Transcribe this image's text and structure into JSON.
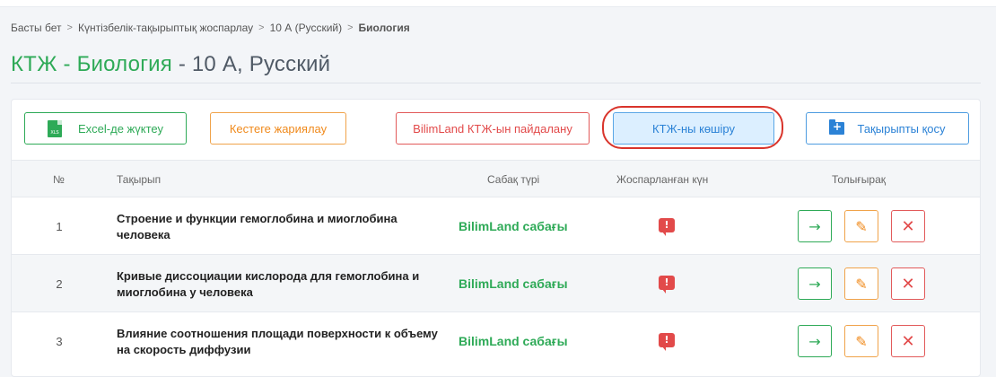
{
  "breadcrumb": {
    "items": [
      "Басты бет",
      "Күнтізбелік-тақырыптық жоспарлау",
      "10 А (Русский)"
    ],
    "current": "Биология",
    "separator": ">"
  },
  "title": {
    "highlight": "КТЖ - Биология",
    "rest": "- 10 А, Русский"
  },
  "toolbar": {
    "excel_label": "Excel-де жүктеу",
    "excel_icon_text": "XLS",
    "schedule_label": "Кестеге жариялау",
    "bilimland_label": "BilimLand КТЖ-ын пайдалану",
    "copy_label": "КТЖ-ны көшіру",
    "add_topic_label": "Тақырыпты қосу"
  },
  "table": {
    "headers": {
      "num": "№",
      "topic": "Тақырып",
      "type": "Сабақ түрі",
      "planned_date": "Жоспарланған күн",
      "details": "Толығырақ"
    },
    "rows": [
      {
        "num": "1",
        "topic": "Строение и функции гемоглобина и миоглобина человека",
        "type": "BilimLand сабағы",
        "alert": "!"
      },
      {
        "num": "2",
        "topic": "Кривые диссоциации кислорода для гемоглобина и миоглобина у человека",
        "type": "BilimLand сабағы",
        "alert": "!"
      },
      {
        "num": "3",
        "topic": "Влияние соотношения площади поверхности к объему на скорость диффузии",
        "type": "BilimLand сабағы",
        "alert": "!"
      }
    ]
  },
  "colors": {
    "green": "#2eaa57",
    "orange": "#f08a1c",
    "red": "#e24a4a",
    "blue": "#2b82d6",
    "highlight_ring": "#d9342b"
  },
  "icons": {
    "excel": "xls-file-icon",
    "add_topic": "folder-plus-icon",
    "alert": "alert-comment-icon",
    "go": "arrow-right-icon",
    "edit": "pencil-icon",
    "delete": "close-icon"
  }
}
